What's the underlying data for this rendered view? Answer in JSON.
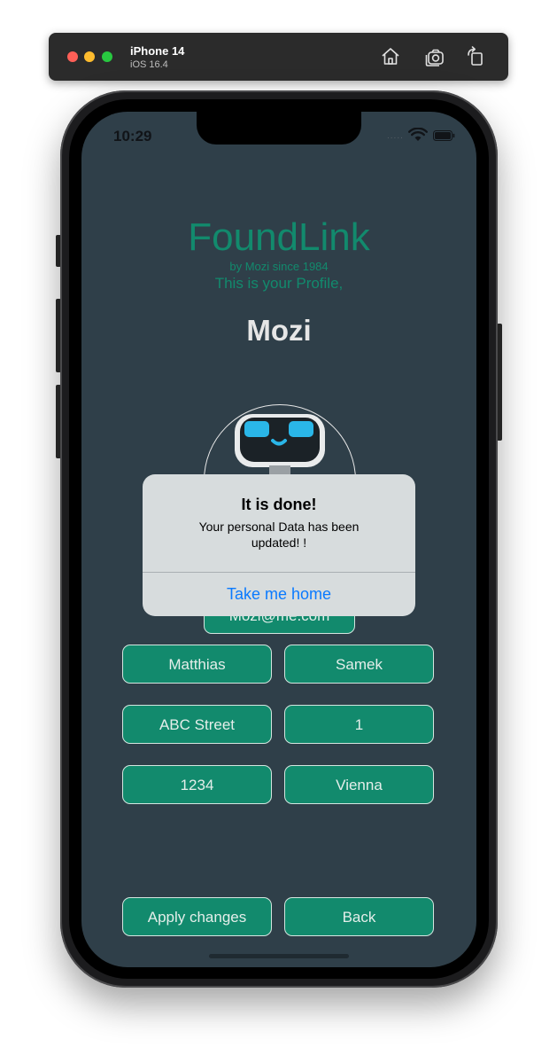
{
  "simulator": {
    "device_name": "iPhone 14",
    "os_version": "iOS 16.4",
    "toolbar_icons": [
      "home-icon",
      "screenshot-icon",
      "rotate-icon"
    ]
  },
  "status_bar": {
    "time": "10:29",
    "signal": ".....",
    "icons": [
      "wifi-icon",
      "battery-icon"
    ]
  },
  "header": {
    "app_title": "FoundLink",
    "app_subtitle": "by Mozi since 1984",
    "profile_line": "This is your Profile,",
    "username": "Mozi"
  },
  "avatar": {
    "icon": "robot-avatar-icon"
  },
  "form": {
    "email": "Mozi@me.com",
    "first_name": "Matthias",
    "last_name": "Samek",
    "street": "ABC Street",
    "house_number": "1",
    "postal_code": "1234",
    "city": "Vienna"
  },
  "actions": {
    "apply_label": "Apply changes",
    "back_label": "Back"
  },
  "alert": {
    "title": "It is done!",
    "message": "Your personal Data has been updated! !",
    "button_label": "Take me home"
  },
  "colors": {
    "screen_background": "#2f3f49",
    "accent": "#128a6d",
    "alert_link": "#0a7aff"
  }
}
